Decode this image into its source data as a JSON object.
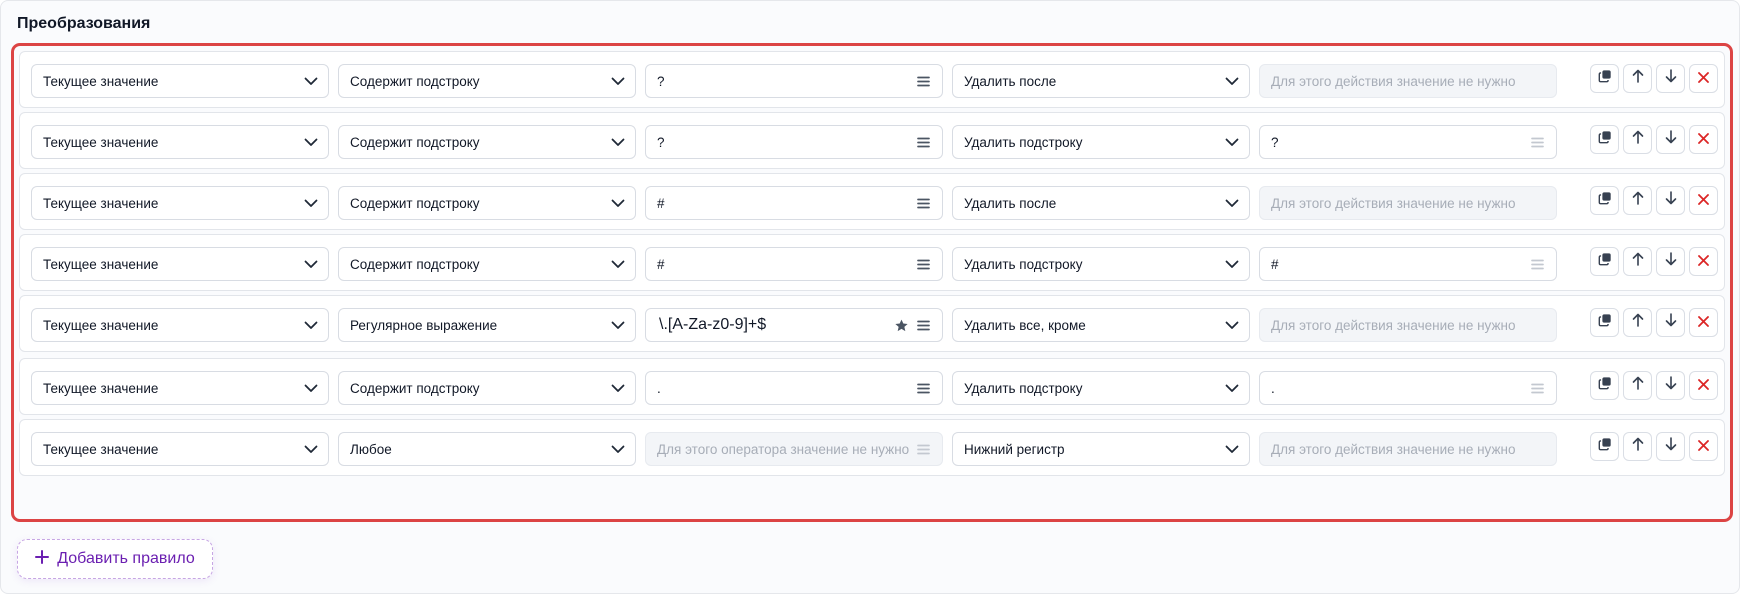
{
  "section_title": "Преобразования",
  "colors": {
    "delete": "#dc2626",
    "accent": "#6b1fb1",
    "highlight_border": "#dc4444"
  },
  "icons": {
    "select": "chevron-down-icon",
    "value_menu": "menu-icon",
    "favorite": "star-icon",
    "copy": "copy-icon",
    "up": "arrow-up-icon",
    "down": "arrow-down-icon",
    "delete": "close-icon",
    "add": "plus-icon"
  },
  "rules": [
    {
      "source": "Текущее значение",
      "operator": "Содержит подстроку",
      "value": "?",
      "action": "Удалить после",
      "action_value": "Для этого действия значение не нужно",
      "action_value_disabled": true
    },
    {
      "source": "Текущее значение",
      "operator": "Содержит подстроку",
      "value": "?",
      "action": "Удалить подстроку",
      "action_value": "?",
      "action_value_disabled": false
    },
    {
      "source": "Текущее значение",
      "operator": "Содержит подстроку",
      "value": "#",
      "action": "Удалить после",
      "action_value": "Для этого действия значение не нужно",
      "action_value_disabled": true
    },
    {
      "source": "Текущее значение",
      "operator": "Содержит подстроку",
      "value": "#",
      "action": "Удалить подстроку",
      "action_value": "#",
      "action_value_disabled": false
    },
    {
      "source": "Текущее значение",
      "operator": "Регулярное выражение",
      "value": "\\.[A-Za-z0-9]+$",
      "action": "Удалить все, кроме",
      "action_value": "Для этого действия значение не нужно",
      "action_value_disabled": true,
      "value_regex": true
    },
    {
      "source": "Текущее значение",
      "operator": "Содержит подстроку",
      "value": ".",
      "action": "Удалить подстроку",
      "action_value": ".",
      "action_value_disabled": false
    },
    {
      "source": "Текущее значение",
      "operator": "Любое",
      "value": "Для этого оператора значение не нужно",
      "value_disabled": true,
      "action": "Нижний регистр",
      "action_value": "Для этого действия значение не нужно",
      "action_value_disabled": true
    }
  ],
  "add_rule_label": "Добавить правило"
}
